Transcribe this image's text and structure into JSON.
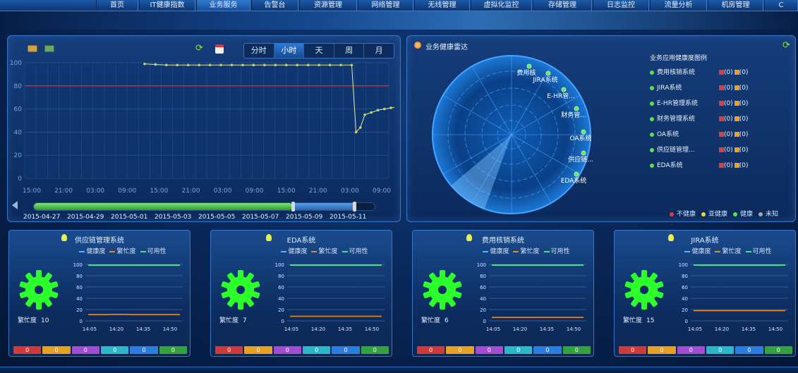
{
  "nav": {
    "items": [
      {
        "label": "首页",
        "active": false
      },
      {
        "label": "IT健康指数",
        "active": false
      },
      {
        "label": "业务服务",
        "active": true
      },
      {
        "label": "告警台",
        "active": false
      },
      {
        "label": "资源管理",
        "active": false
      },
      {
        "label": "网络管理",
        "active": false
      },
      {
        "label": "无线管理",
        "active": false
      },
      {
        "label": "虚拟化监控",
        "active": false
      },
      {
        "label": "存储管理",
        "active": false
      },
      {
        "label": "日志监控",
        "active": false
      },
      {
        "label": "流量分析",
        "active": false
      },
      {
        "label": "机房管理",
        "active": false
      },
      {
        "label": "C",
        "active": false
      }
    ]
  },
  "main_chart": {
    "period_tabs": [
      {
        "label": "分时",
        "active": false
      },
      {
        "label": "小时",
        "active": true
      },
      {
        "label": "天",
        "active": false
      },
      {
        "label": "周",
        "active": false
      },
      {
        "label": "月",
        "active": false
      }
    ],
    "slider_dates": [
      "2015-04-27",
      "2015-04-29",
      "2015-05-01",
      "2015-05-03",
      "2015-05-05",
      "2015-05-07",
      "2015-05-09",
      "2015-05-11"
    ],
    "slider_position": 0.76,
    "slider_selection_end": 0.94
  },
  "chart_data": {
    "type": "line",
    "title": "",
    "xlabel": "",
    "ylabel": "",
    "ylim": [
      0,
      100
    ],
    "yticks": [
      0,
      20,
      40,
      60,
      80,
      100
    ],
    "xticks": [
      "15:00",
      "21:00",
      "03:00",
      "09:00",
      "15:00",
      "21:00",
      "03:00",
      "09:00",
      "15:00",
      "21:00",
      "03:00",
      "09:00"
    ],
    "threshold": 80,
    "colors": {
      "line": "#e8e8a0",
      "threshold": "#d6262b",
      "marker": "#c8d84a"
    },
    "x": [
      0,
      0.5,
      1,
      1.5,
      2,
      2.5,
      3,
      3.5,
      4,
      4.5,
      5,
      5.5,
      6,
      6.5,
      7,
      7.5,
      8,
      8.5,
      9,
      9.5,
      9.7,
      9.9,
      10.1,
      10.4,
      10.7,
      11.0,
      11.3,
      11.6,
      11.9,
      12.2,
      12.5,
      12.8,
      13.1,
      13.4,
      13.7,
      14.0,
      14.3,
      14.6,
      14.9,
      15.2,
      15.5,
      15.8,
      16.1,
      16.4,
      16.7
    ],
    "y": [
      99,
      98.5,
      98,
      98,
      98,
      98,
      98,
      98,
      98,
      98,
      98,
      98,
      98,
      98,
      98,
      98,
      98,
      98,
      98,
      98,
      40,
      44,
      55,
      57,
      59,
      60,
      61,
      62,
      63,
      64,
      65,
      66,
      67,
      68,
      69,
      70,
      71,
      72,
      73,
      73.5,
      74,
      75,
      75.5,
      76,
      77
    ]
  },
  "radar": {
    "title": "业务健康雷达",
    "legend_title": "业务应用健康度图例",
    "systems": [
      {
        "name": "费用核销系统",
        "radar_label": "费用核"
      },
      {
        "name": "JIRA系统",
        "radar_label": "JIRA系统"
      },
      {
        "name": "E-HR管理系统",
        "radar_label": "E-HR管..."
      },
      {
        "name": "财务管理系统",
        "radar_label": "财务管..."
      },
      {
        "name": "OA系统",
        "radar_label": "OA系统"
      },
      {
        "name": "供应链管理...",
        "radar_label": "供应链..."
      },
      {
        "name": "EDA系统",
        "radar_label": "EDA系统"
      }
    ],
    "count_red": "(0)",
    "count_orange": "(0)",
    "status_legend": [
      {
        "label": "不健康",
        "color": "#e23b3b"
      },
      {
        "label": "亚健康",
        "color": "#e8d83a"
      },
      {
        "label": "健康",
        "color": "#5ee04a"
      },
      {
        "label": "未知",
        "color": "#a7a7a7"
      }
    ]
  },
  "cards": [
    {
      "title": "供应链管理系统",
      "busy_label": "繁忙度",
      "busy_value": "10",
      "busy_series": [
        11,
        11,
        11.5,
        11,
        11,
        11,
        11
      ]
    },
    {
      "title": "EDA系统",
      "busy_label": "繁忙度",
      "busy_value": "7",
      "busy_series": [
        8,
        8,
        8,
        8,
        8,
        8,
        8
      ]
    },
    {
      "title": "费用核销系统",
      "busy_label": "繁忙度",
      "busy_value": "6",
      "busy_series": [
        6,
        6,
        6,
        6,
        6,
        6,
        6
      ]
    },
    {
      "title": "JIRA系统",
      "busy_label": "繁忙度",
      "busy_value": "15",
      "busy_series": [
        18,
        18,
        18,
        18,
        18,
        18,
        18
      ]
    }
  ],
  "card_common": {
    "legend": [
      "健康度",
      "繁忙度",
      "可用性"
    ],
    "legend_colors": [
      "#53b6ff",
      "#e98a23",
      "#47e27a"
    ],
    "yticks": [
      0,
      20,
      40,
      60,
      80,
      100
    ],
    "xticks": [
      "14:05",
      "14:20",
      "14:35",
      "14:50"
    ],
    "status_values": [
      "0",
      "0",
      "0",
      "0",
      "0",
      "0"
    ],
    "status_colors": [
      "#d23a3a",
      "#e7a01f",
      "#a34bd1",
      "#2bb7c7",
      "#2b7de0",
      "#34a33d"
    ]
  }
}
